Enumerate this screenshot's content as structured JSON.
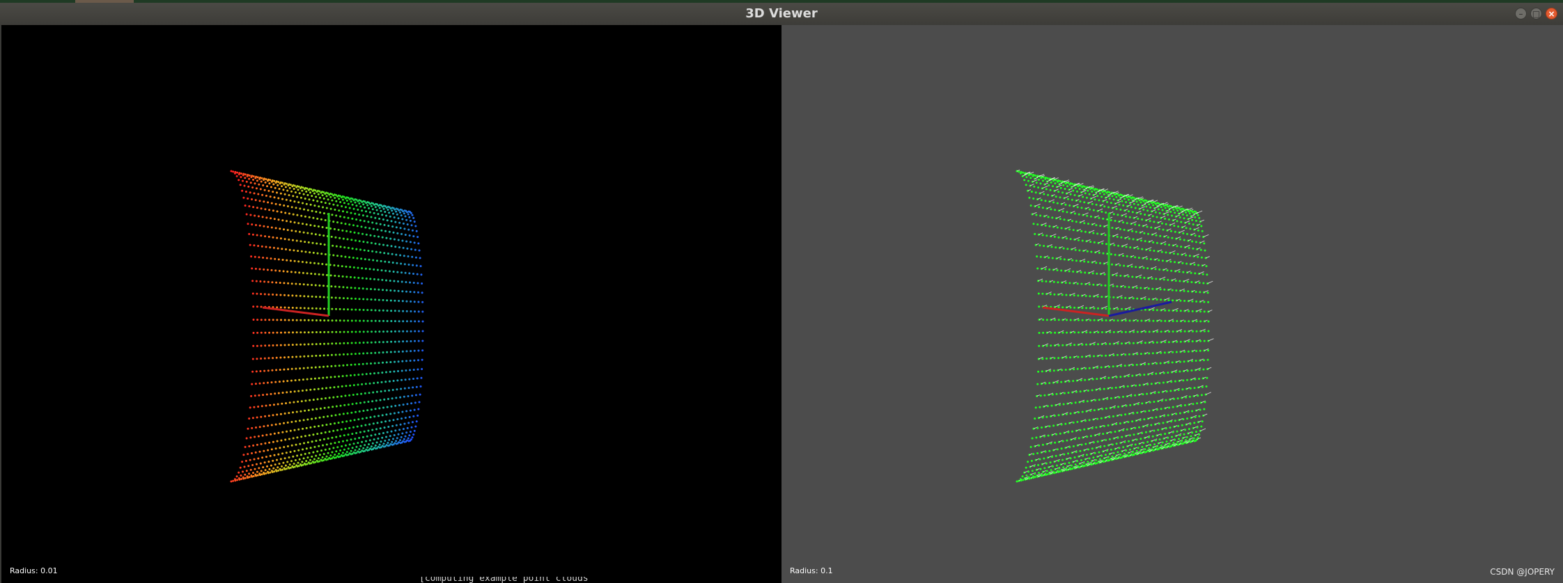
{
  "window": {
    "title": "3D Viewer",
    "buttons": {
      "minimize_glyph": "–",
      "maximize_glyph": "□",
      "close_glyph": "×"
    }
  },
  "viewports": [
    {
      "id": "left",
      "background": "#000000",
      "radius_label": "Radius: 0.01",
      "point_coloring": "height-colormap (red → yellow → green → blue)",
      "axis_colors": {
        "x": "#cc2222",
        "y": "#22cc22",
        "z": "#2233dd"
      }
    },
    {
      "id": "right",
      "background": "#4c4c4c",
      "radius_label": "Radius: 0.1",
      "point_color": "#22ff22",
      "normal_color": "#ffffff",
      "axis_colors": {
        "x": "#cc2222",
        "y": "#22cc22",
        "z": "#1a1aa0"
      }
    }
  ],
  "watermark": "CSDN @JOPERY",
  "terminal_peek": "[computing example point clouds"
}
